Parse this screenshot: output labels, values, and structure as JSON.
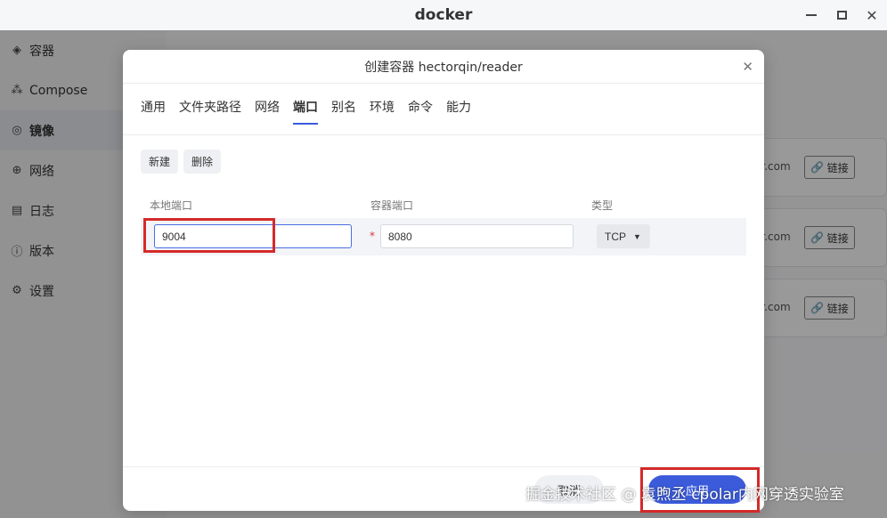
{
  "window": {
    "title": "docker"
  },
  "sidebar": {
    "items": [
      {
        "label": "容器",
        "icon": "layers-icon"
      },
      {
        "label": "Compose",
        "icon": "cubes-icon"
      },
      {
        "label": "镜像",
        "icon": "disc-icon",
        "active": true
      },
      {
        "label": "网络",
        "icon": "globe-icon"
      },
      {
        "label": "日志",
        "icon": "document-icon"
      },
      {
        "label": "版本",
        "icon": "info-icon"
      },
      {
        "label": "设置",
        "icon": "gear-icon"
      }
    ]
  },
  "background": {
    "cards": [
      {
        "domain": "er.com",
        "link_label": "链接"
      },
      {
        "domain": "er.com",
        "link_label": "链接"
      },
      {
        "domain": "er.com",
        "link_label": "链接"
      }
    ]
  },
  "dialog": {
    "title": "创建容器 hectorqin/reader",
    "tabs": [
      "通用",
      "文件夹路径",
      "网络",
      "端口",
      "别名",
      "环境",
      "命令",
      "能力"
    ],
    "active_tab": "端口",
    "buttons": {
      "new": "新建",
      "delete": "删除"
    },
    "columns": {
      "local": "本地端口",
      "container": "容器端口",
      "type": "类型"
    },
    "row": {
      "local_port": "9004",
      "required_mark": "*",
      "container_port": "8080",
      "type": "TCP"
    },
    "footer": {
      "cancel": "取消",
      "ok": "应用"
    }
  },
  "watermark": "掘金技术社区 @ 袁煦丞 cpolar内网穿透实验室",
  "colors": {
    "accent": "#3b5bdb",
    "annotation": "#d42a2a"
  }
}
